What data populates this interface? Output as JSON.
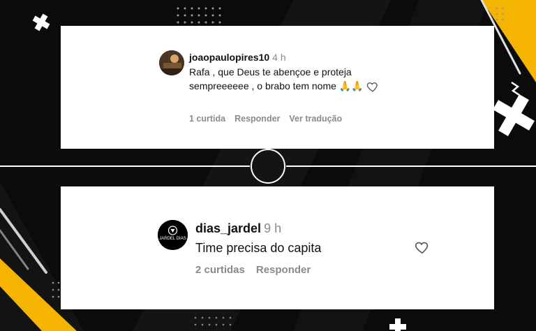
{
  "comments": [
    {
      "username": "joaopaulopires10",
      "time": "4 h",
      "text": "Rafa , que Deus te abençoe e proteja sempreeeeee , o brabo tem nome",
      "emoji": "🙏🙏",
      "likes": "1 curtida",
      "reply": "Responder",
      "translate": "Ver tradução"
    },
    {
      "username": "dias_jardel",
      "time": "9 h",
      "avatar_text": "JARDEL DIAS",
      "text": "Time precisa do capita",
      "likes": "2 curtidas",
      "reply": "Responder"
    }
  ],
  "colors": {
    "background": "#0b0b0b",
    "accent_yellow": "#f5b400",
    "card": "#ffffff",
    "muted_text": "#8a8a8a"
  }
}
